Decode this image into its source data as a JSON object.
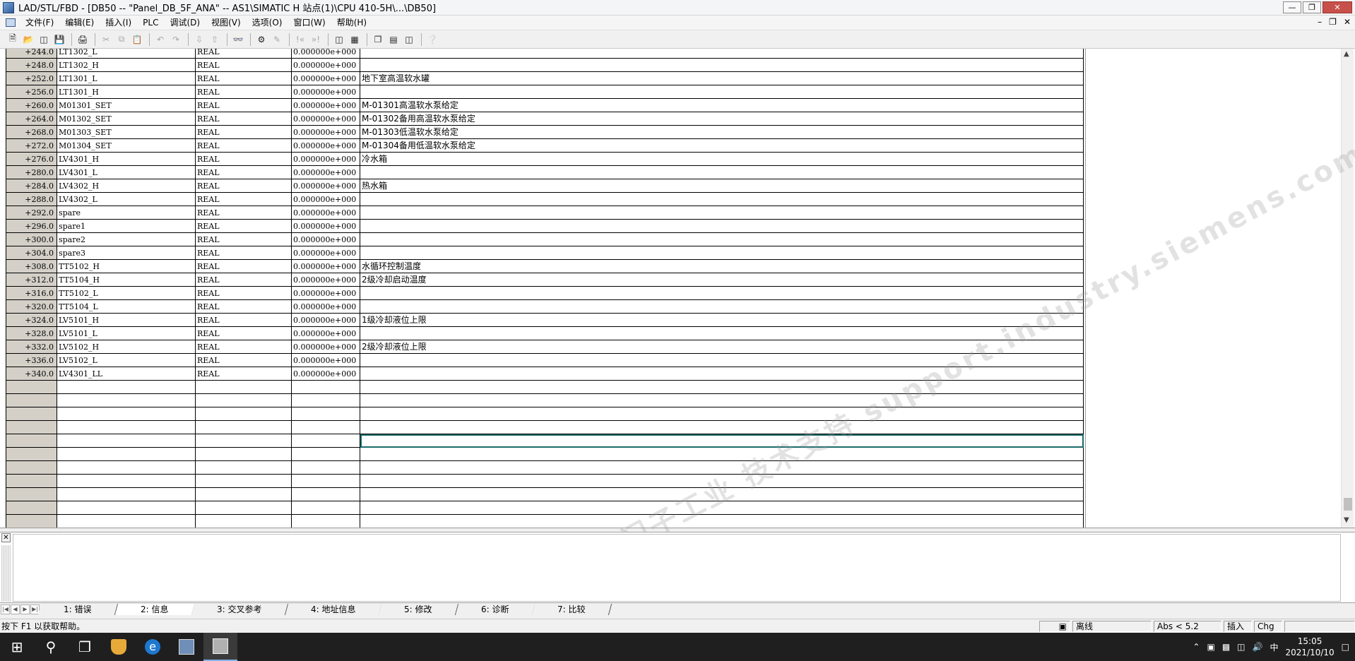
{
  "window": {
    "title": "LAD/STL/FBD  - [DB50 -- \"Panel_DB_5F_ANA\" -- AS1\\SIMATIC H 站点(1)\\CPU 410-5H\\...\\DB50]"
  },
  "menu": {
    "items": [
      "文件(F)",
      "编辑(E)",
      "插入(I)",
      "PLC",
      "调试(D)",
      "视图(V)",
      "选项(O)",
      "窗口(W)",
      "帮助(H)"
    ]
  },
  "table": {
    "rows": [
      {
        "addr": "+244.0",
        "name": "LT1302_L",
        "type": "REAL",
        "init": "0.000000e+000",
        "comment": ""
      },
      {
        "addr": "+248.0",
        "name": "LT1302_H",
        "type": "REAL",
        "init": "0.000000e+000",
        "comment": ""
      },
      {
        "addr": "+252.0",
        "name": "LT1301_L",
        "type": "REAL",
        "init": "0.000000e+000",
        "comment": "地下室高温软水罐"
      },
      {
        "addr": "+256.0",
        "name": "LT1301_H",
        "type": "REAL",
        "init": "0.000000e+000",
        "comment": ""
      },
      {
        "addr": "+260.0",
        "name": "M01301_SET",
        "type": "REAL",
        "init": "0.000000e+000",
        "comment": "M-01301高温软水泵给定"
      },
      {
        "addr": "+264.0",
        "name": "M01302_SET",
        "type": "REAL",
        "init": "0.000000e+000",
        "comment": "M-01302备用高温软水泵给定"
      },
      {
        "addr": "+268.0",
        "name": "M01303_SET",
        "type": "REAL",
        "init": "0.000000e+000",
        "comment": "M-01303低温软水泵给定"
      },
      {
        "addr": "+272.0",
        "name": "M01304_SET",
        "type": "REAL",
        "init": "0.000000e+000",
        "comment": "M-01304备用低温软水泵给定"
      },
      {
        "addr": "+276.0",
        "name": "LV4301_H",
        "type": "REAL",
        "init": "0.000000e+000",
        "comment": "冷水箱"
      },
      {
        "addr": "+280.0",
        "name": "LV4301_L",
        "type": "REAL",
        "init": "0.000000e+000",
        "comment": ""
      },
      {
        "addr": "+284.0",
        "name": "LV4302_H",
        "type": "REAL",
        "init": "0.000000e+000",
        "comment": "热水箱"
      },
      {
        "addr": "+288.0",
        "name": "LV4302_L",
        "type": "REAL",
        "init": "0.000000e+000",
        "comment": ""
      },
      {
        "addr": "+292.0",
        "name": "spare",
        "type": "REAL",
        "init": "0.000000e+000",
        "comment": ""
      },
      {
        "addr": "+296.0",
        "name": "spare1",
        "type": "REAL",
        "init": "0.000000e+000",
        "comment": ""
      },
      {
        "addr": "+300.0",
        "name": "spare2",
        "type": "REAL",
        "init": "0.000000e+000",
        "comment": ""
      },
      {
        "addr": "+304.0",
        "name": "spare3",
        "type": "REAL",
        "init": "0.000000e+000",
        "comment": ""
      },
      {
        "addr": "+308.0",
        "name": "TT5102_H",
        "type": "REAL",
        "init": "0.000000e+000",
        "comment": "水循环控制温度"
      },
      {
        "addr": "+312.0",
        "name": "TT5104_H",
        "type": "REAL",
        "init": "0.000000e+000",
        "comment": "2级冷却启动温度"
      },
      {
        "addr": "+316.0",
        "name": "TT5102_L",
        "type": "REAL",
        "init": "0.000000e+000",
        "comment": ""
      },
      {
        "addr": "+320.0",
        "name": "TT5104_L",
        "type": "REAL",
        "init": "0.000000e+000",
        "comment": ""
      },
      {
        "addr": "+324.0",
        "name": "LV5101_H",
        "type": "REAL",
        "init": "0.000000e+000",
        "comment": "1级冷却液位上限"
      },
      {
        "addr": "+328.0",
        "name": "LV5101_L",
        "type": "REAL",
        "init": "0.000000e+000",
        "comment": ""
      },
      {
        "addr": "+332.0",
        "name": "LV5102_H",
        "type": "REAL",
        "init": "0.000000e+000",
        "comment": "2级冷却液位上限"
      },
      {
        "addr": "+336.0",
        "name": "LV5102_L",
        "type": "REAL",
        "init": "0.000000e+000",
        "comment": ""
      },
      {
        "addr": "+340.0",
        "name": "LV4301_LL",
        "type": "REAL",
        "init": "0.000000e+000",
        "comment": ""
      }
    ],
    "empty_row_count": 12,
    "selected_empty_row": 4
  },
  "watermark": "西门子工业 技术支持 support.industry.siemens.com",
  "tabs": [
    {
      "label": "1: 错误",
      "active": false
    },
    {
      "label": "2: 信息",
      "active": true
    },
    {
      "label": "3: 交叉参考",
      "active": false
    },
    {
      "label": "4: 地址信息",
      "active": false
    },
    {
      "label": "5: 修改",
      "active": false
    },
    {
      "label": "6: 诊断",
      "active": false
    },
    {
      "label": "7: 比较",
      "active": false
    }
  ],
  "statusbar": {
    "help_text": "按下 F1 以获取帮助。",
    "mode": "离线",
    "abs": "Abs < 5.2",
    "insert": "插入",
    "chg": "Chg"
  },
  "taskbar": {
    "ime": "中",
    "time": "15:05",
    "date": "2021/10/10"
  }
}
